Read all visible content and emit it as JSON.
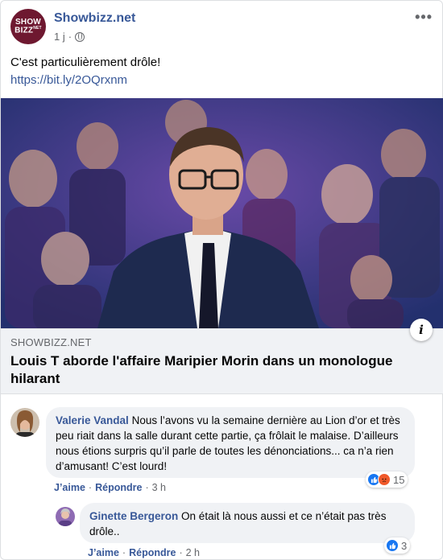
{
  "post": {
    "page_name": "Showbizz.net",
    "avatar_line1": "SHOW",
    "avatar_line2": "BIZZ",
    "avatar_suffix": "NET",
    "time": "1 j",
    "text": "C'est particulièrement drôle!",
    "link": "https://bit.ly/2OQrxnm",
    "more_label": "•••"
  },
  "preview": {
    "domain": "SHOWBIZZ.NET",
    "headline": "Louis T aborde l'affaire Maripier Morin dans un monologue hilarant",
    "info_label": "i"
  },
  "comments": [
    {
      "author": "Valerie Vandal",
      "text": "Nous l’avons vu la semaine dernière au Lion d’or et très peu riait dans la salle durant cette partie, ça frôlait le malaise. D’ailleurs nous étions surpris qu’il parle de toutes les dénonciations... ca n’a rien d’amusant! C’est lourd!",
      "like_label": "J’aime",
      "reply_label": "Répondre",
      "time": "3 h",
      "reaction_count": "15",
      "reactions": [
        "like-icon",
        "angry-icon"
      ]
    },
    {
      "author": "Ginette Bergeron",
      "text": "On était là nous aussi et ce n’était pas très drôle..",
      "like_label": "J’aime",
      "reply_label": "Répondre",
      "time": "2 h",
      "reaction_count": "3",
      "reactions": [
        "like-icon"
      ]
    }
  ],
  "colors": {
    "link": "#385898",
    "bubble": "#f0f2f5",
    "like": "#1877f2",
    "angry": "#f0592a",
    "brand": "#6e1830"
  }
}
